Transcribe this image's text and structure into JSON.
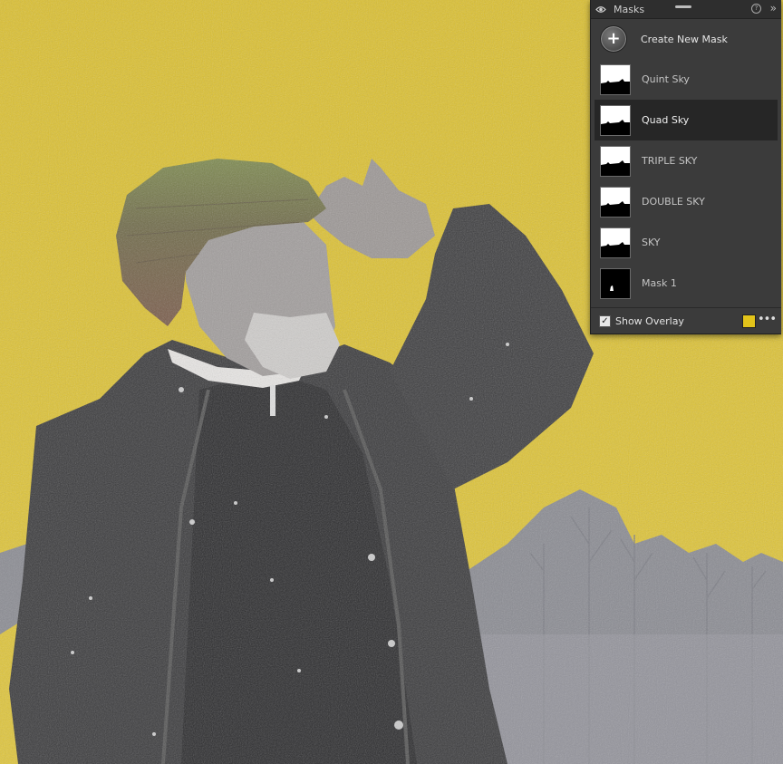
{
  "panel": {
    "title": "Masks",
    "create_label": "Create New Mask",
    "masks": [
      {
        "label": "Quint Sky",
        "selected": false,
        "thumb": "sky"
      },
      {
        "label": "Quad Sky",
        "selected": true,
        "thumb": "sky"
      },
      {
        "label": "TRIPLE SKY",
        "selected": false,
        "thumb": "sky"
      },
      {
        "label": "DOUBLE SKY",
        "selected": false,
        "thumb": "sky"
      },
      {
        "label": "SKY",
        "selected": false,
        "thumb": "sky"
      },
      {
        "label": "Mask 1",
        "selected": false,
        "thumb": "subject"
      }
    ],
    "show_overlay_label": "Show Overlay",
    "show_overlay_checked": true,
    "overlay_color": "#e3c41a"
  },
  "icons": {
    "visibility": "eye-icon",
    "help": "help-icon",
    "collapse": "double-chevron-icon",
    "add": "plus-icon",
    "more": "more-options-icon"
  },
  "colors": {
    "overlay_sky": "#ddc12f",
    "panel_bg": "#3b3b3b",
    "selected_row": "#262626"
  }
}
